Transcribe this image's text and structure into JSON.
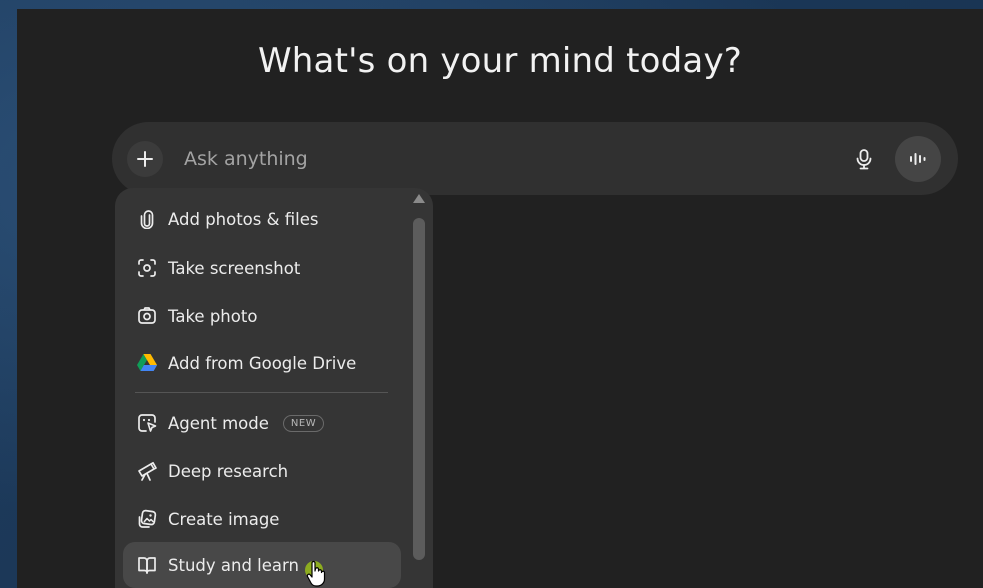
{
  "page": {
    "title": "What's on your mind today?"
  },
  "composer": {
    "placeholder": "Ask anything",
    "plus_icon": "plus-icon",
    "mic_icon": "microphone-icon",
    "voice_icon": "voice-waveform-icon"
  },
  "menu": {
    "items": [
      {
        "label": "Add photos & files",
        "icon": "paperclip-icon"
      },
      {
        "label": "Take screenshot",
        "icon": "screenshot-icon"
      },
      {
        "label": "Take photo",
        "icon": "camera-icon"
      },
      {
        "label": "Add from Google Drive",
        "icon": "google-drive-icon"
      },
      {
        "label": "Agent mode",
        "icon": "agent-cursor-icon",
        "badge": "NEW"
      },
      {
        "label": "Deep research",
        "icon": "telescope-icon"
      },
      {
        "label": "Create image",
        "icon": "image-create-icon"
      },
      {
        "label": "Study and learn",
        "icon": "book-icon",
        "hovered": true
      }
    ]
  },
  "colors": {
    "window_bg": "#212121",
    "composer_bg": "#303030",
    "menu_bg": "#353535",
    "hover_bg": "#484848",
    "text": "#ececec",
    "placeholder": "#a3a3a3",
    "cursor_highlight": "#c6ff00"
  }
}
